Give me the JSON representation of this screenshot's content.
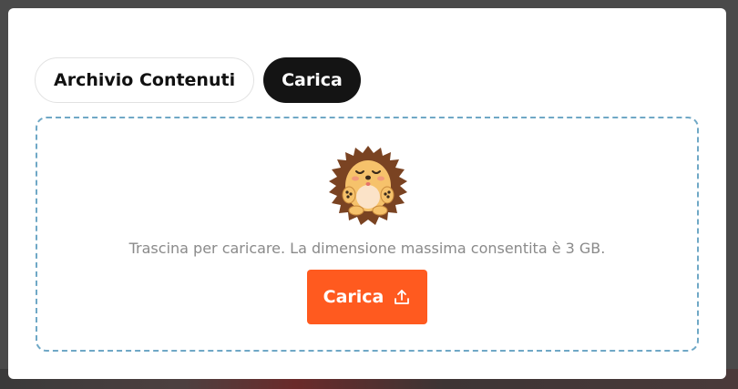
{
  "tabs": [
    {
      "label": "Archivio Contenuti",
      "active": false
    },
    {
      "label": "Carica",
      "active": true
    }
  ],
  "dropzone": {
    "hint": "Trascina per caricare. La dimensione massima consentita è 3 GB.",
    "upload_label": "Carica",
    "mascot_icon": "hedgehog-mascot-icon",
    "upload_icon": "upload-icon"
  },
  "colors": {
    "accent": "#ff5a1f",
    "tab_active_bg": "#141414",
    "dropzone_border": "#6fa8c6",
    "hint_text": "#8a8a8a"
  }
}
